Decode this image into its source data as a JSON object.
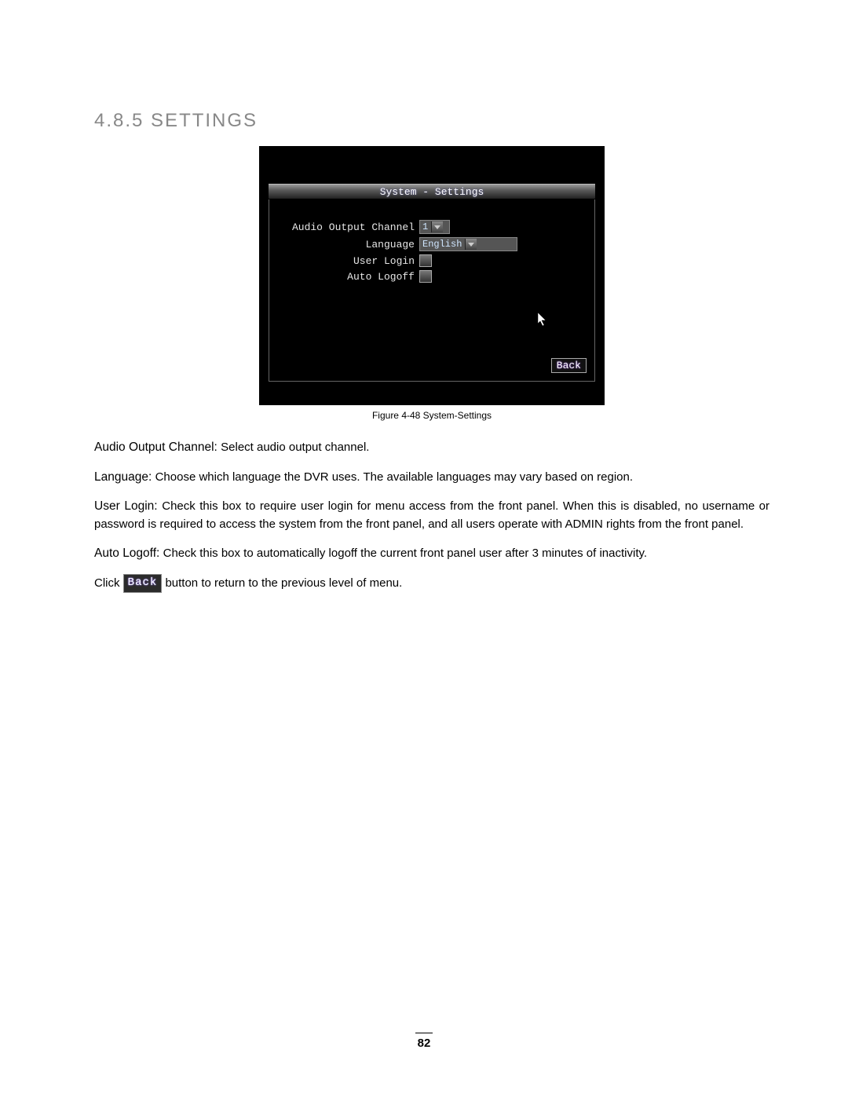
{
  "heading": "4.8.5 SETTINGS",
  "screenshot": {
    "title": "System - Settings",
    "fields": {
      "audio_label": "Audio Output Channel",
      "audio_value": "1",
      "language_label": "Language",
      "language_value": "English",
      "userlogin_label": "User Login",
      "autologoff_label": "Auto Logoff"
    },
    "back_label": "Back"
  },
  "figure_caption": "Figure 4-48 System-Settings",
  "paragraphs": {
    "audio": {
      "lead": "Audio Output Channel: ",
      "body": "Select audio output channel."
    },
    "language": {
      "lead": "Language: ",
      "body": "Choose which language the DVR uses. The available languages may vary based on region."
    },
    "userlogin": {
      "lead": "User Login: ",
      "body": "Check this box to require user login for menu access from the front panel. When this is disabled, no username or password is required to access the system from the front panel, and all users operate with ADMIN rights from the front panel."
    },
    "autologoff": {
      "lead": "Auto Logoff: ",
      "body": "Check this box to automatically logoff the current front panel user after 3 minutes of inactivity."
    },
    "click": {
      "pre": "Click ",
      "btn": "Back",
      "post": " button to return to the previous level of menu."
    }
  },
  "page_number": "82"
}
